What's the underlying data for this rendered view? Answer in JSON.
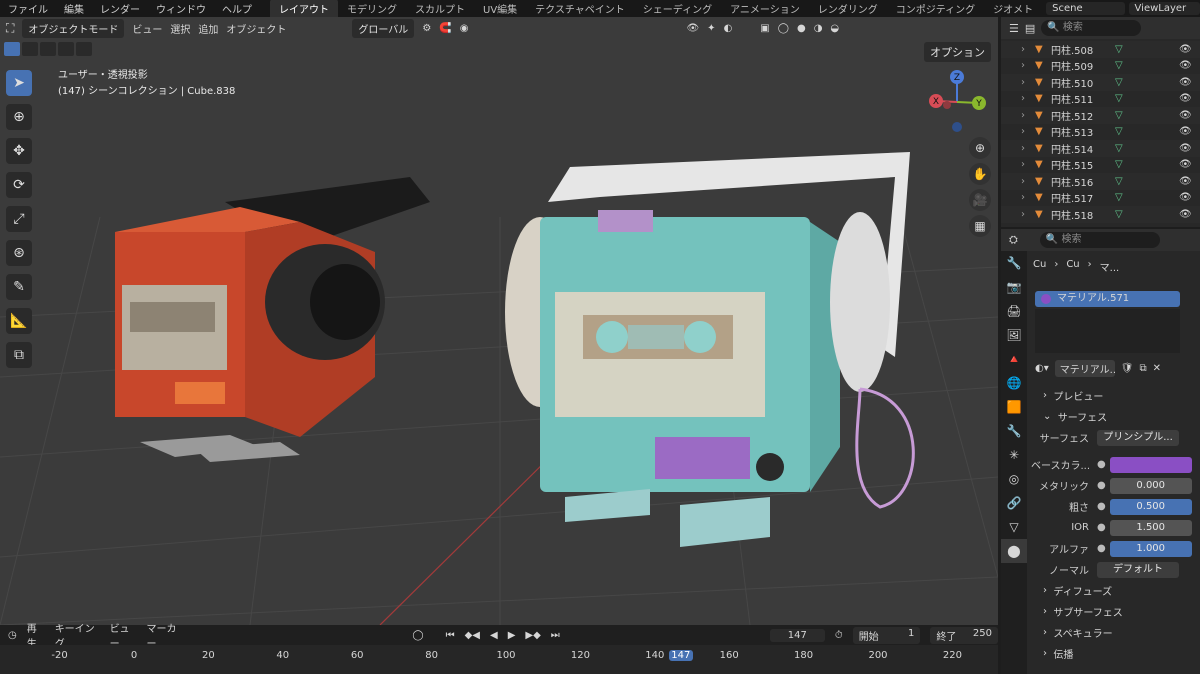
{
  "topbar": {
    "menus": [
      "ファイル",
      "編集",
      "レンダー",
      "ウィンドウ",
      "ヘルプ"
    ],
    "tabs": [
      "レイアウト",
      "モデリング",
      "スカルプト",
      "UV編集",
      "テクスチャペイント",
      "シェーディング",
      "アニメーション",
      "レンダリング",
      "コンポジティング",
      "ジオメト"
    ],
    "scene": "Scene",
    "view_layer": "ViewLayer"
  },
  "viewport_header": {
    "mode": "オブジェクトモード",
    "menus": [
      "ビュー",
      "選択",
      "追加",
      "オブジェクト"
    ],
    "orientation": "グローバル",
    "options": "オプション"
  },
  "viewport_info": {
    "line1": "ユーザー・透視投影",
    "line2": "(147) シーンコレクション | Cube.838"
  },
  "gizmo": {
    "z": "Z",
    "x": "X",
    "y": "Y"
  },
  "outliner": {
    "search_placeholder": "検索",
    "items": [
      "円柱.508",
      "円柱.509",
      "円柱.510",
      "円柱.511",
      "円柱.512",
      "円柱.513",
      "円柱.514",
      "円柱.515",
      "円柱.516",
      "円柱.517",
      "円柱.518"
    ]
  },
  "properties": {
    "search_placeholder": "検索",
    "breadcrumb": [
      "Cu",
      "Cu",
      "マ..."
    ],
    "material_slot": "マテリアル.571",
    "material_name": "マテリアル....",
    "sections": {
      "preview": "プレビュー",
      "surface": "サーフェス",
      "diffuse": "ディフューズ",
      "subsurface": "サブサーフェス",
      "specular": "スペキュラー",
      "transmission": "伝播"
    },
    "surface_label": "サーフェス",
    "surface_value": "プリンシプル...",
    "rows": [
      {
        "label": "ベースカラ...",
        "value": "",
        "type": "color"
      },
      {
        "label": "メタリック",
        "value": "0.000",
        "type": "gray"
      },
      {
        "label": "粗さ",
        "value": "0.500",
        "type": "blue"
      },
      {
        "label": "IOR",
        "value": "1.500",
        "type": "gray"
      },
      {
        "label": "アルファ",
        "value": "1.000",
        "type": "blue"
      }
    ],
    "normal_label": "ノーマル",
    "normal_value": "デフォルト",
    "base_color": "#8a4fc4"
  },
  "timeline": {
    "menus": [
      "再生",
      "キーイング",
      "ビュー",
      "マーカー"
    ],
    "current_frame": "147",
    "start_label": "開始",
    "start": "1",
    "end_label": "終了",
    "end": "250",
    "ruler": [
      "-20",
      "0",
      "20",
      "40",
      "60",
      "80",
      "100",
      "120",
      "140",
      "147",
      "160",
      "180",
      "200",
      "220"
    ]
  }
}
